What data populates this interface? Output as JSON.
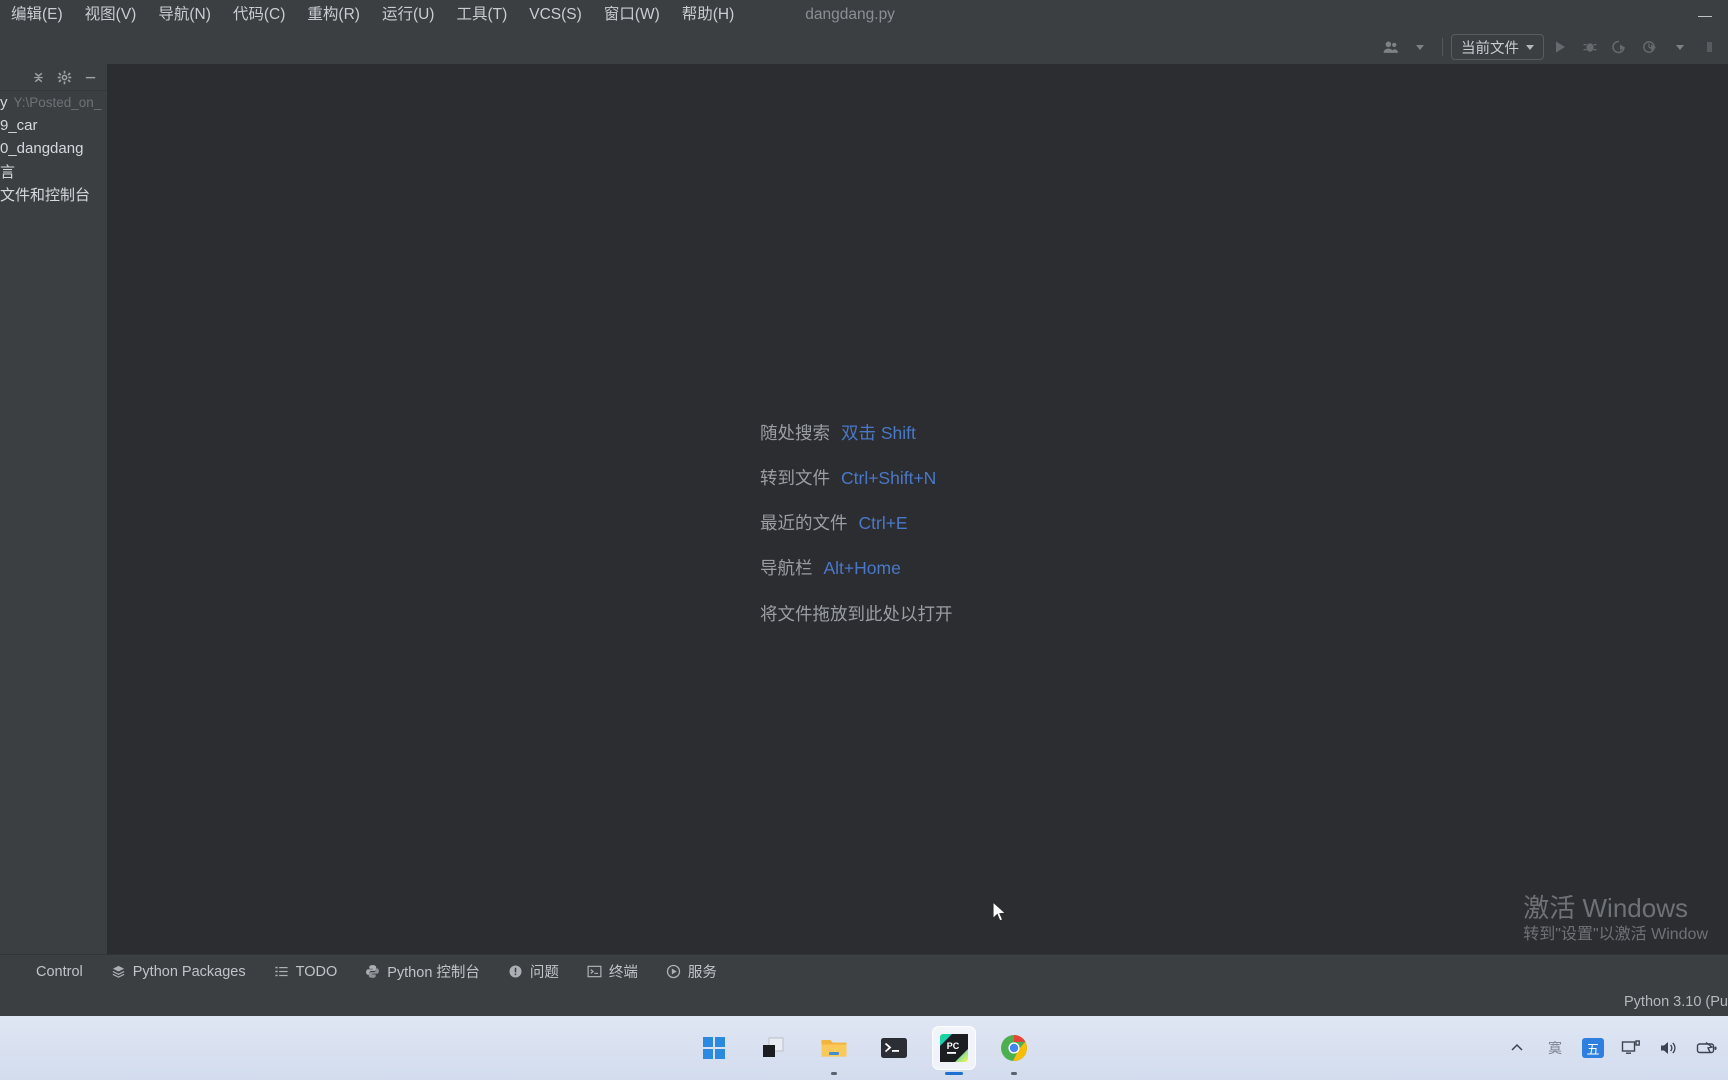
{
  "window": {
    "title_file": "dangdang.py",
    "minimize_label": "—",
    "maximize_label": "▢",
    "close_label": "✕"
  },
  "menu": {
    "items": [
      {
        "label": "编辑(E)",
        "mnemonic": "E"
      },
      {
        "label": "视图(V)",
        "mnemonic": "V"
      },
      {
        "label": "导航(N)",
        "mnemonic": "N"
      },
      {
        "label": "代码(C)",
        "mnemonic": "C"
      },
      {
        "label": "重构(R)",
        "mnemonic": "R"
      },
      {
        "label": "运行(U)",
        "mnemonic": "U"
      },
      {
        "label": "工具(T)",
        "mnemonic": "T"
      },
      {
        "label": "VCS(S)",
        "mnemonic": "S"
      },
      {
        "label": "窗口(W)",
        "mnemonic": "W"
      },
      {
        "label": "帮助(H)",
        "mnemonic": "H"
      }
    ]
  },
  "toolbar": {
    "run_config_label": "当前文件",
    "icons": [
      "user-avatar-icon",
      "run-icon",
      "debug-icon",
      "run-coverage-icon",
      "profile-icon",
      "more-chevron-icon",
      "stop-icon"
    ]
  },
  "sidebar": {
    "toolbar_icons": [
      "collapse-all-icon",
      "settings-gear-icon",
      "hide-panel-icon"
    ],
    "tree": [
      {
        "label": "y",
        "path": "Y:\\Posted_on_"
      },
      {
        "label": "9_car",
        "path": ""
      },
      {
        "label": "0_dangdang",
        "path": ""
      },
      {
        "label": "言",
        "path": ""
      },
      {
        "label": "文件和控制台",
        "path": ""
      }
    ]
  },
  "editor": {
    "welcome_rows": [
      {
        "label": "随处搜索",
        "key": "双击 Shift"
      },
      {
        "label": "转到文件",
        "key": "Ctrl+Shift+N"
      },
      {
        "label": "最近的文件",
        "key": "Ctrl+E"
      },
      {
        "label": "导航栏",
        "key": "Alt+Home"
      }
    ],
    "drop_hint": "将文件拖放到此处以打开"
  },
  "watermark": {
    "line1": "激活 Windows",
    "line2": "转到\"设置\"以激活 Window"
  },
  "toolwindows": {
    "items": [
      {
        "label": "Control",
        "icon": "version-control-icon"
      },
      {
        "label": "Python Packages",
        "icon": "packages-icon"
      },
      {
        "label": "TODO",
        "icon": "todo-list-icon"
      },
      {
        "label": "Python 控制台",
        "icon": "python-console-icon"
      },
      {
        "label": "问题",
        "icon": "problems-icon"
      },
      {
        "label": "终端",
        "icon": "terminal-icon"
      },
      {
        "label": "服务",
        "icon": "services-icon"
      }
    ]
  },
  "statusbar": {
    "interpreter": "Python 3.10 (Pu"
  },
  "taskbar": {
    "apps": [
      {
        "name": "start-button",
        "running": false,
        "active": false
      },
      {
        "name": "task-view-button",
        "running": false,
        "active": false
      },
      {
        "name": "file-explorer-button",
        "running": true,
        "active": false
      },
      {
        "name": "terminal-button",
        "running": false,
        "active": false
      },
      {
        "name": "pycharm-button",
        "running": true,
        "active": true
      },
      {
        "name": "chrome-button",
        "running": true,
        "active": false
      }
    ],
    "tray": {
      "ime_badge": "五"
    }
  },
  "colors": {
    "editor_bg": "#2b2d30",
    "panel_bg": "#3c3f41",
    "accent_blue": "#4a78c8",
    "text_muted": "#9a9ea3"
  }
}
